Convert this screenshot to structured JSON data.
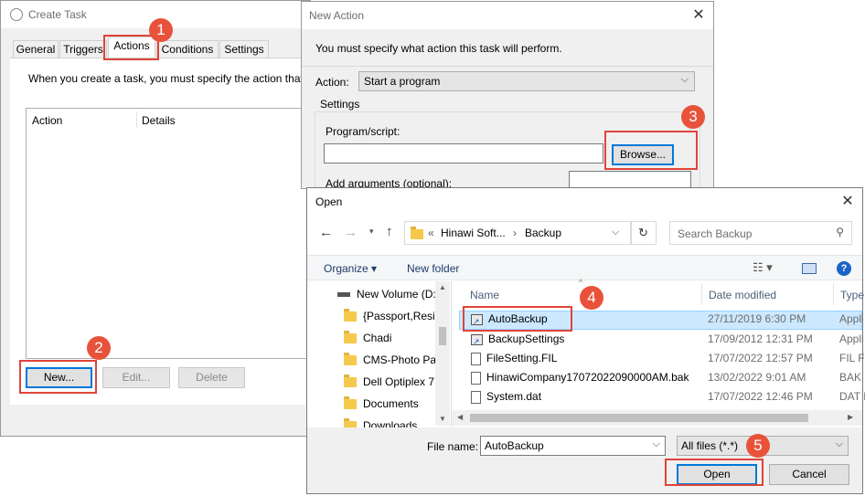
{
  "create_task": {
    "title": "Create Task",
    "tabs": [
      "General",
      "Triggers",
      "Actions",
      "Conditions",
      "Settings"
    ],
    "description": "When you create a task, you must specify the action that",
    "columns": [
      "Action",
      "Details"
    ],
    "buttons": {
      "new": "New...",
      "edit": "Edit...",
      "delete": "Delete"
    }
  },
  "new_action": {
    "title": "New Action",
    "instruction": "You must specify what action this task will perform.",
    "action_label": "Action:",
    "action_value": "Start a program",
    "settings_label": "Settings",
    "program_label": "Program/script:",
    "program_value": "",
    "browse_button": "Browse...",
    "arguments_label": "Add arguments (optional):"
  },
  "open_dialog": {
    "title": "Open",
    "breadcrumb": {
      "prefix": "«",
      "part1": "Hinawi Soft...",
      "sep": "›",
      "part2": "Backup"
    },
    "search_placeholder": "Search Backup",
    "organize_label": "Organize ▾",
    "new_folder_label": "New folder",
    "tree": [
      "New Volume (D:",
      "{Passport,Resic",
      "Chadi",
      "CMS-Photo Pa",
      "Dell Optiplex 7",
      "Documents",
      "Downloads"
    ],
    "columns": {
      "name": "Name",
      "date": "Date modified",
      "type": "Type"
    },
    "files": [
      {
        "name": "AutoBackup",
        "date": "27/11/2019 6:30 PM",
        "type": "Appli",
        "icon": "shortcut-icon"
      },
      {
        "name": "BackupSettings",
        "date": "17/09/2012 12:31 PM",
        "type": "Appli",
        "icon": "shortcut-icon"
      },
      {
        "name": "FileSetting.FIL",
        "date": "17/07/2022 12:57 PM",
        "type": "FIL Fi",
        "icon": "file-icon"
      },
      {
        "name": "HinawiCompany17072022090000AM.bak",
        "date": "13/02/2022 9:01 AM",
        "type": "BAK F",
        "icon": "file-icon"
      },
      {
        "name": "System.dat",
        "date": "17/07/2022 12:46 PM",
        "type": "DAT F",
        "icon": "file-icon"
      }
    ],
    "filename_label": "File name:",
    "filename_value": "AutoBackup",
    "filetype_value": "All files (*.*)",
    "open_button": "Open",
    "cancel_button": "Cancel"
  },
  "markers": [
    "1",
    "2",
    "3",
    "4",
    "5"
  ],
  "colors": {
    "marker": "#e8523b",
    "highlight": "#e0443b",
    "focus": "#0078d7",
    "selection": "#cce8ff"
  }
}
